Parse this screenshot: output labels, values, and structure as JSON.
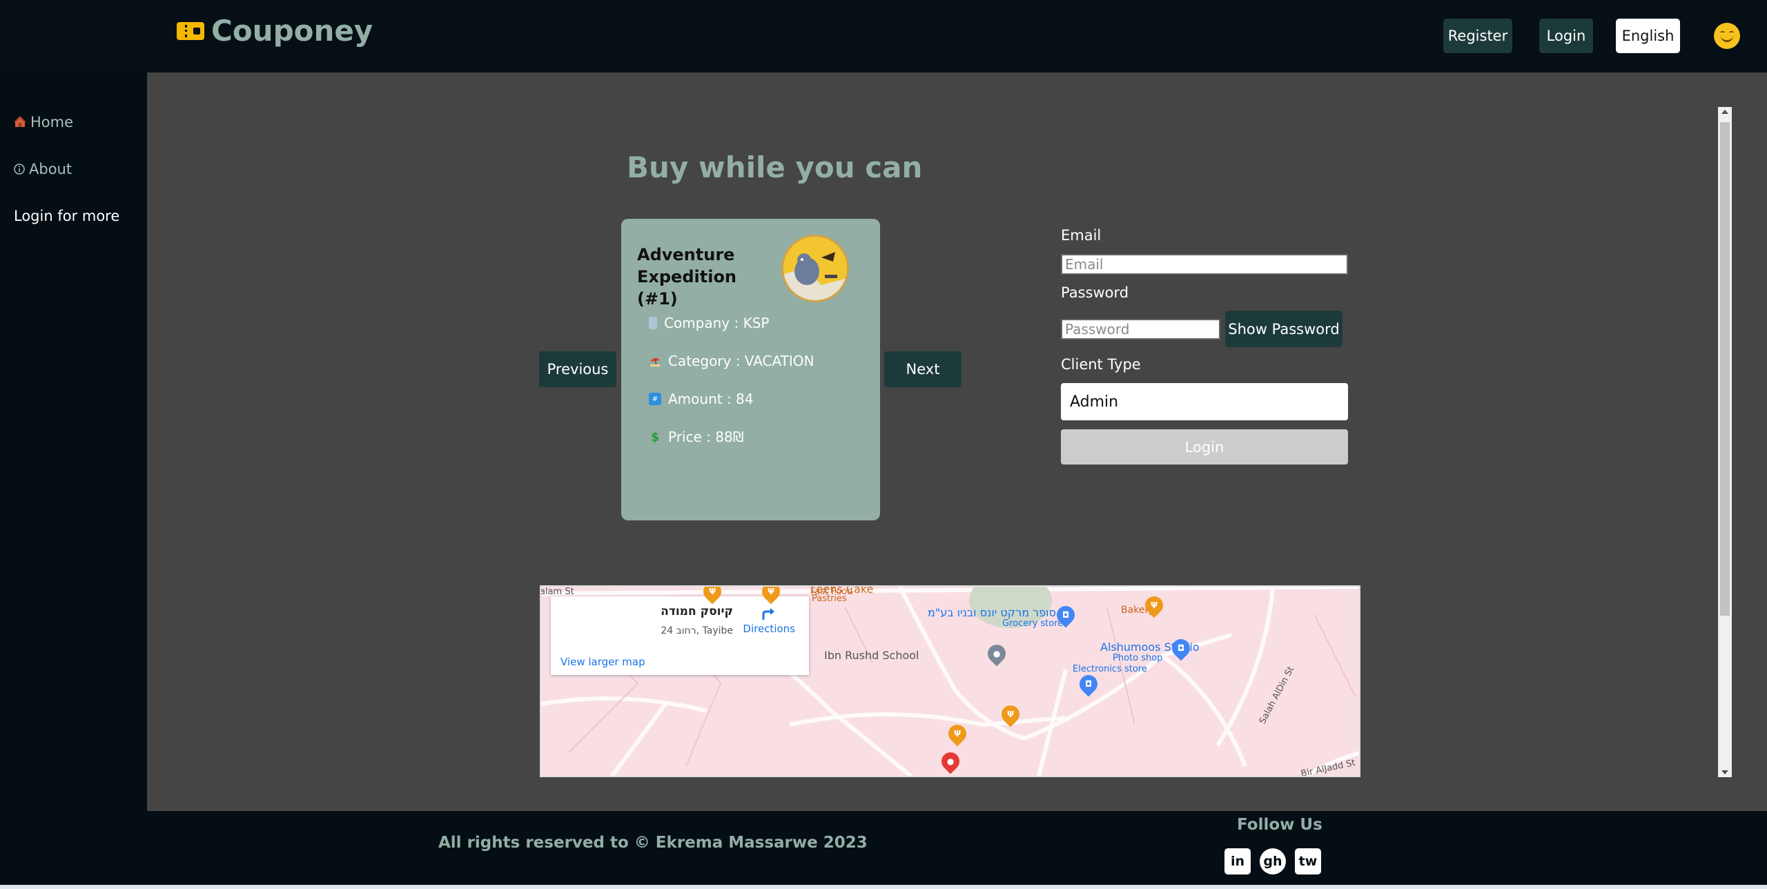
{
  "header": {
    "logo_text": "Couponey",
    "register_label": "Register",
    "login_label": "Login",
    "language_label": "English"
  },
  "sidebar": {
    "items": [
      {
        "label": "Home"
      },
      {
        "label": "About"
      },
      {
        "label": "Login for more"
      }
    ]
  },
  "main": {
    "title": "Buy while you can",
    "carousel": {
      "previous_label": "Previous",
      "next_label": "Next",
      "card": {
        "title": "Adventure Expedition (#1)",
        "company": "Company : KSP",
        "category": "Category : VACATION",
        "amount": "Amount : 84",
        "price": "Price : 88₪"
      }
    },
    "login_form": {
      "email_label": "Email",
      "email_placeholder": "Email",
      "password_label": "Password",
      "password_placeholder": "Password",
      "show_password_label": "Show Password",
      "client_type_label": "Client Type",
      "client_type_value": "Admin",
      "submit_label": "Login"
    },
    "map": {
      "place_name": "קיוסק חמודה",
      "place_address": "רחוב 24, Tayibe",
      "directions_label": "Directions",
      "larger_map_label": "View larger map",
      "labels": {
        "school": "Ibn Rushd School",
        "studio": "Alshumoos Studio",
        "studio_sub": "Photo shop",
        "electronics": "Electronics store",
        "grocery": "סופר מרקט יונס ובניו בע\"מ",
        "grocery_sub": "Grocery store",
        "bakery": "Bakery",
        "cake": "Leens Cake",
        "cake_sub": "Pastries",
        "fastfood": "Fast Food",
        "street1": "Salah AlDin St",
        "street2": "Bir AlJadd St",
        "street3": "alam St"
      }
    }
  },
  "footer": {
    "copyright": "All rights reserved to © Ekrema Massarwe 2023",
    "follow_label": "Follow Us",
    "social": [
      "in",
      "gh",
      "tw"
    ]
  }
}
